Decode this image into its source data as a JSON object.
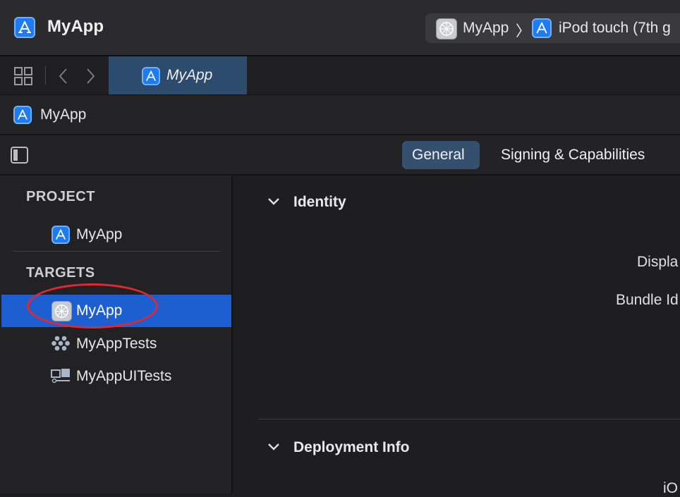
{
  "window": {
    "title": "MyApp",
    "scheme_target": "MyApp",
    "scheme_separator": "〉",
    "scheme_device": "iPod touch (7th g"
  },
  "tabbar": {
    "active_tab": "MyApp"
  },
  "breadcrumb": {
    "label": "MyApp"
  },
  "editor_tabs": [
    {
      "label": "General",
      "active": true
    },
    {
      "label": "Signing & Capabilities",
      "active": false
    }
  ],
  "sidebar": {
    "project_header": "PROJECT",
    "project_items": [
      {
        "label": "MyApp"
      }
    ],
    "targets_header": "TARGETS",
    "target_items": [
      {
        "label": "MyApp",
        "selected": true
      },
      {
        "label": "MyAppTests",
        "selected": false
      },
      {
        "label": "MyAppUITests",
        "selected": false
      }
    ]
  },
  "content": {
    "identity_title": "Identity",
    "identity_fields": [
      "Displa",
      "Bundle Id"
    ],
    "deployment_title": "Deployment Info",
    "deployment_fields": [
      "iO"
    ]
  },
  "colors": {
    "accent": "#1d5fd1",
    "tab_active": "#2d4b6d",
    "annotation": "#e4262e"
  }
}
